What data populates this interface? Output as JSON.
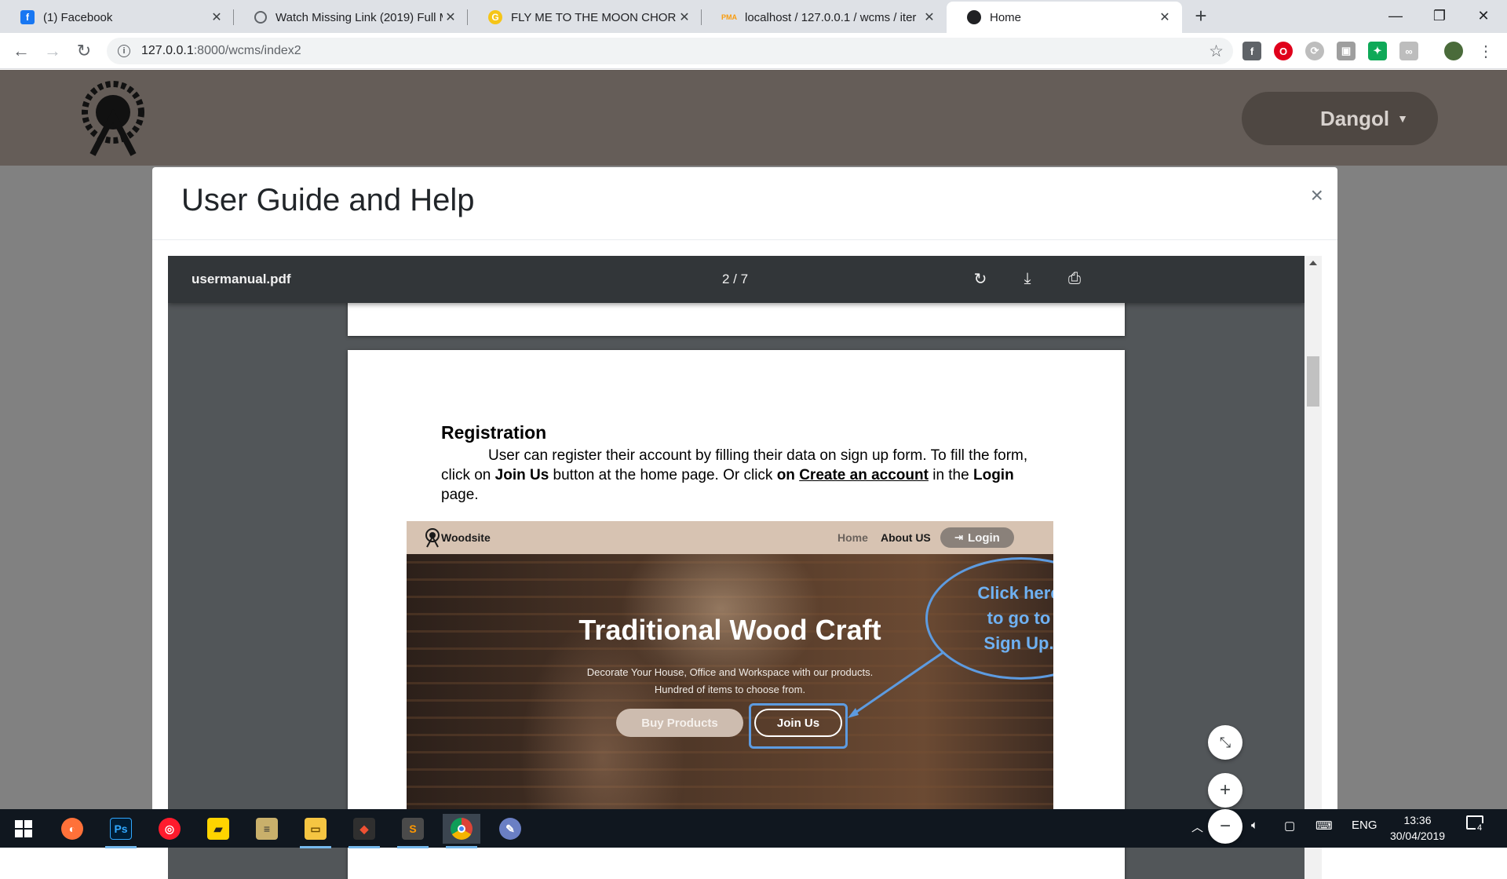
{
  "browser": {
    "tabs": [
      {
        "title": "(1) Facebook",
        "icon": "facebook-icon",
        "color": "#1877f2"
      },
      {
        "title": "Watch Missing Link (2019) Full M",
        "icon": "globe-icon",
        "color": "#5f6368"
      },
      {
        "title": "FLY ME TO THE MOON CHORDS",
        "icon": "ug-icon",
        "color": "#f5c518"
      },
      {
        "title": "localhost / 127.0.0.1 / wcms / iter",
        "icon": "phpmyadmin-icon",
        "color": "#f89c0e"
      },
      {
        "title": "Home",
        "icon": "site-logo-icon",
        "color": "#202124",
        "active": true
      }
    ],
    "url_host": "127.0.0.1",
    "url_path": ":8000/wcms/index2"
  },
  "site": {
    "user_name": "Dangol"
  },
  "modal": {
    "title": "User Guide and Help",
    "close": "×"
  },
  "pdf": {
    "filename": "usermanual.pdf",
    "page_indicator": "2 / 7",
    "heading": "Registration",
    "para_1": "User can register their account by filling their data on sign up form. To fill the form, click on ",
    "join_us": "Join Us",
    "para_2": " button at the home page. Or click ",
    "on": "on ",
    "create_account": "Create an account",
    "para_3": " in the ",
    "login": "Login",
    "para_4": " page."
  },
  "screenshot": {
    "brand": "Woodsite",
    "nav_home": "Home",
    "nav_about": "About US",
    "nav_login": "Login",
    "hero_title": "Traditional Wood Craft",
    "hero_sub_1": "Decorate Your House, Office and Workspace with our products.",
    "hero_sub_2": "Hundred of items to choose from.",
    "buy_button": "Buy Products",
    "join_button": "Join Us",
    "callout_1": "Click here",
    "callout_2": "to go to",
    "callout_3": "Sign Up."
  },
  "taskbar": {
    "language": "ENG",
    "time": "13:36",
    "date": "30/04/2019",
    "notifications": "4"
  }
}
